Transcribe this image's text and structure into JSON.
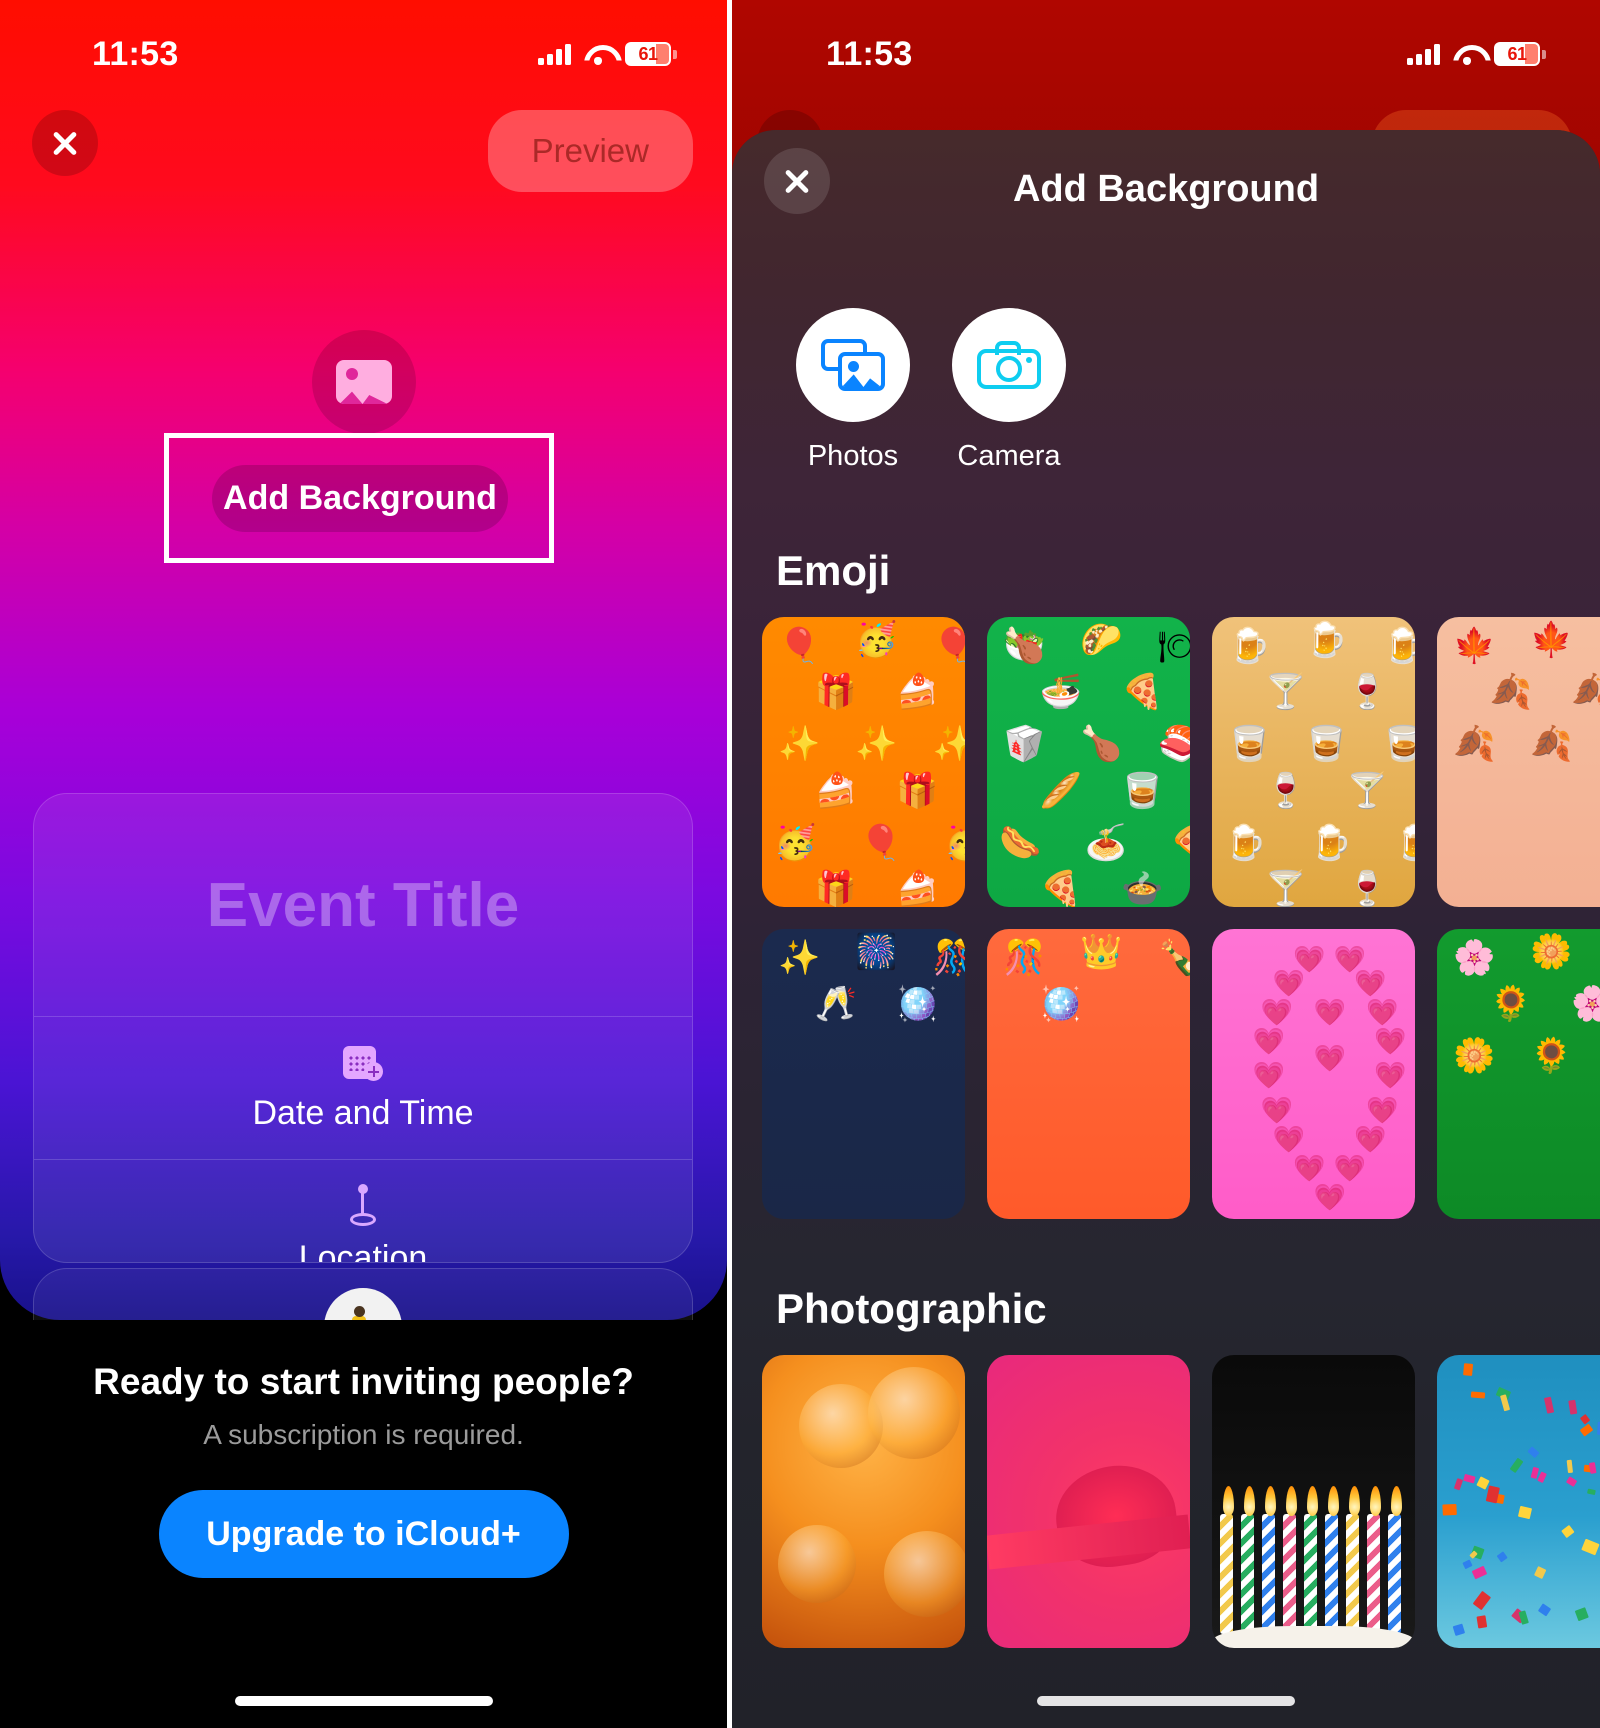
{
  "left_screen": {
    "status_bar": {
      "time": "11:53",
      "battery_percent": "61",
      "wifi_icon": "wifi-icon",
      "cellular_icon": "cellular-signal-icon"
    },
    "close_button_icon": "close-icon",
    "preview_button_label": "Preview",
    "background_placeholder_icon": "photo-placeholder-icon",
    "add_background_label": "Add Background",
    "event_card": {
      "title_placeholder": "Event Title",
      "date_icon": "calendar-add-icon",
      "date_label": "Date and Time",
      "location_icon": "map-pin-icon",
      "location_label": "Location"
    },
    "upsell": {
      "headline": "Ready to start inviting people?",
      "subtext": "A subscription is required.",
      "cta_label": "Upgrade to iCloud+"
    }
  },
  "right_screen": {
    "status_bar": {
      "time": "11:53",
      "battery_percent": "61",
      "wifi_icon": "wifi-icon",
      "cellular_icon": "cellular-signal-icon"
    },
    "sheet": {
      "close_icon": "close-icon",
      "title": "Add Background",
      "sources": [
        {
          "label": "Photos",
          "icon": "photos-library-icon"
        },
        {
          "label": "Camera",
          "icon": "camera-icon"
        }
      ],
      "sections": [
        {
          "title": "Emoji",
          "items": [
            {
              "name": "birthday-party-emoji-background",
              "bg": "linear-gradient(180deg,#ff8a00 0%,#ff7a00 100%)",
              "emojis": [
                "🎈",
                "🥳",
                "🎈",
                "🎁",
                "🍰",
                "✨",
                "✨",
                "✨",
                "🍰",
                "🎁",
                "🥳",
                "🎈",
                "🥳",
                "🎁",
                "🍰"
              ]
            },
            {
              "name": "food-emoji-background",
              "bg": "linear-gradient(180deg,#12b34a 0%,#0ea843 100%)",
              "emojis": [
                "🥗",
                "🌮",
                "🍽",
                "🍜",
                "🍕",
                "🥡",
                "🍗",
                "🍣",
                "🥖",
                "🥃",
                "🌭",
                "🍝",
                "🍕",
                "🍕",
                "🍲",
                "🍗"
              ]
            },
            {
              "name": "drinks-emoji-background",
              "bg": "linear-gradient(180deg,#f0c27a 0%,#e0a63f 100%)",
              "emojis": [
                "🍺",
                "🍺",
                "🍺",
                "🍸",
                "🍷",
                "🥃",
                "🥃",
                "🥃",
                "🍷",
                "🍸",
                "🍺",
                "🍺",
                "🍺",
                "🍸",
                "🍷"
              ]
            },
            {
              "name": "autumn-leaves-emoji-background",
              "bg": "linear-gradient(180deg,#f6bfa0 0%,#f3b093 100%)",
              "emojis": [
                "🍁",
                "🍁",
                "🍁",
                "🍂",
                "🍂",
                "🍂",
                "🍂"
              ]
            },
            {
              "name": "fireworks-emoji-background",
              "bg": "linear-gradient(180deg,#1b2a4e 0%,#1a2747 100%)",
              "emojis": [
                "✨",
                "🎆",
                "🎊",
                "🥂",
                "🪩"
              ]
            },
            {
              "name": "celebration-crown-emoji-background",
              "bg": "linear-gradient(180deg,#ff6a3d 0%,#ff5a2a 100%)",
              "emojis": [
                "🎊",
                "👑",
                "🍾",
                "🪩"
              ]
            },
            {
              "name": "hearts-emoji-background",
              "bg": "linear-gradient(180deg,#ff74d4 0%,#ff5cc8 100%)",
              "emojis": [
                "💗"
              ]
            },
            {
              "name": "flowers-emoji-background",
              "bg": "linear-gradient(180deg,#129b2e 0%,#0d8a26 100%)",
              "emojis": [
                "🌸",
                "🌼",
                "🌸",
                "🌻",
                "🌸",
                "🌼",
                "🌻"
              ]
            }
          ]
        },
        {
          "title": "Photographic",
          "items": [
            {
              "name": "cocktail-glasses-photo",
              "bg": "radial-gradient(circle at 50% 30%, #ffb347 0%, #f58f1e 45%, #c24f0b 100%)"
            },
            {
              "name": "pink-gift-ribbon-photo",
              "bg": "radial-gradient(circle at 70% 55%, #ff3b63 0%, #f2326a 40%, #e8297d 100%)"
            },
            {
              "name": "birthday-candles-photo",
              "bg": "linear-gradient(180deg,#0a0a0a 0%,#121212 60%,#1a1a1a 100%)"
            },
            {
              "name": "confetti-photo",
              "bg": "linear-gradient(180deg,#1f8fbf 0%,#2a9fcf 55%,#6cc9e0 100%)"
            }
          ]
        }
      ]
    }
  }
}
